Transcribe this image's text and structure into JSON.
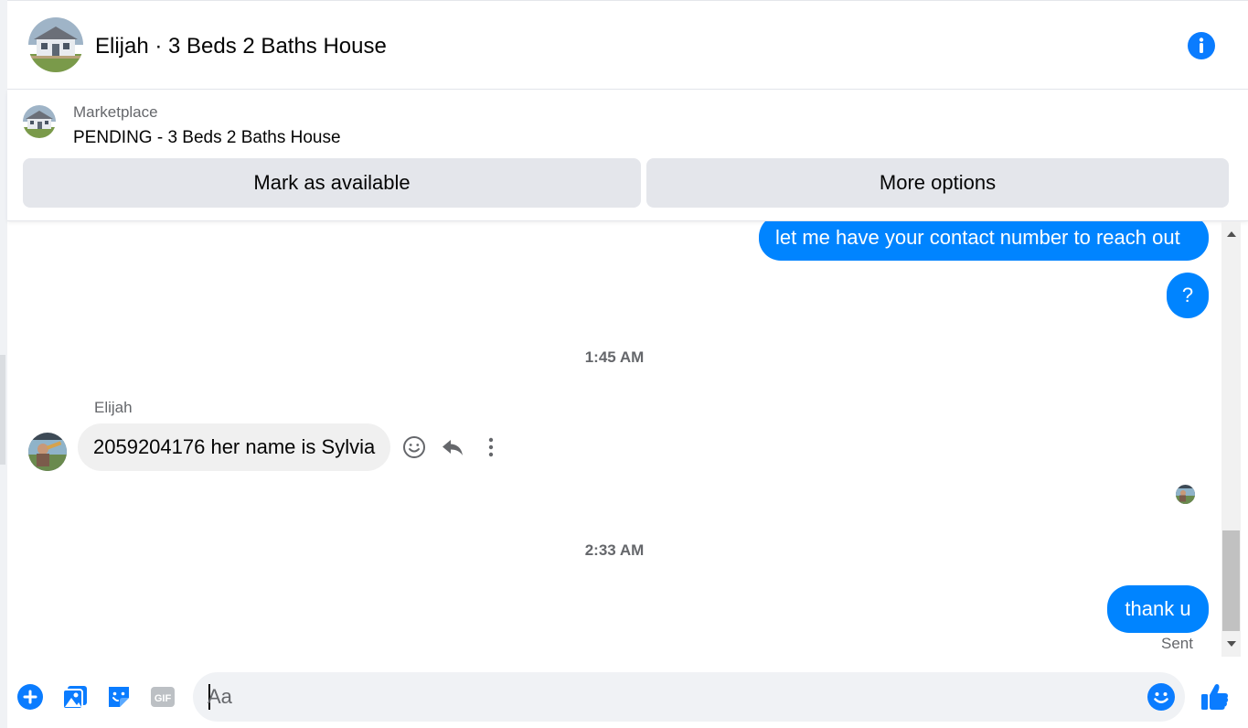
{
  "header": {
    "title": "Elijah · 3 Beds 2 Baths House",
    "avatar_icon": "house-photo-icon",
    "info_icon": "info-icon"
  },
  "marketplace": {
    "label": "Marketplace",
    "listing": "PENDING - 3 Beds 2 Baths House",
    "mark_available_label": "Mark as available",
    "more_options_label": "More options"
  },
  "messages": {
    "outgoing_1": "let me have your contact number to reach out",
    "outgoing_2": "?",
    "timestamp_1": "1:45 AM",
    "sender_name": "Elijah",
    "incoming_1": "2059204176 her name is Sylvia",
    "timestamp_2": "2:33 AM",
    "outgoing_3": "thank u",
    "status": "Sent"
  },
  "composer": {
    "placeholder": "Aa",
    "icons": [
      "plus-icon",
      "photo-icon",
      "sticker-icon",
      "gif-icon",
      "emoji-icon",
      "thumbs-up-icon"
    ],
    "gif_label": "GIF"
  },
  "colors": {
    "accent": "#0084ff",
    "composer_icon": "#0a7cff",
    "gray_text": "#65676b",
    "button_bg": "#e4e6eb"
  }
}
